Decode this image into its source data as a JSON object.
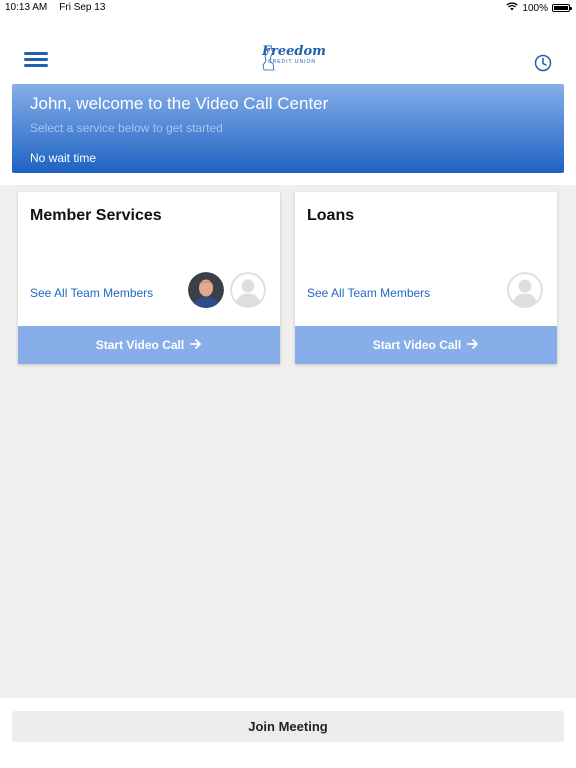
{
  "status_bar": {
    "time": "10:13 AM",
    "date": "Fri Sep 13",
    "battery_percent_label": "100%",
    "battery_level": 1.0,
    "icons": [
      "wifi-icon",
      "battery-icon"
    ]
  },
  "header": {
    "menu_icon": "hamburger-menu-icon",
    "logo_name": "Freedom",
    "logo_subtitle": "CREDIT UNION",
    "history_icon": "clock-icon",
    "brand_color": "#1f5fae"
  },
  "banner": {
    "title": "John, welcome to the Video Call Center",
    "subtitle": "Select a service below to get started",
    "wait_status": "No wait time"
  },
  "services": [
    {
      "name": "Member Services",
      "link_label": "See All Team Members",
      "button_label": "Start Video Call",
      "avatars": [
        "team-member-photo",
        "placeholder-avatar"
      ]
    },
    {
      "name": "Loans",
      "link_label": "See All Team Members",
      "button_label": "Start Video Call",
      "avatars": [
        "placeholder-avatar"
      ]
    }
  ],
  "footer": {
    "join_label": "Join Meeting"
  },
  "colors": {
    "accent": "#2368c4",
    "button_bg": "#87aee9",
    "content_bg": "#f0efed"
  }
}
